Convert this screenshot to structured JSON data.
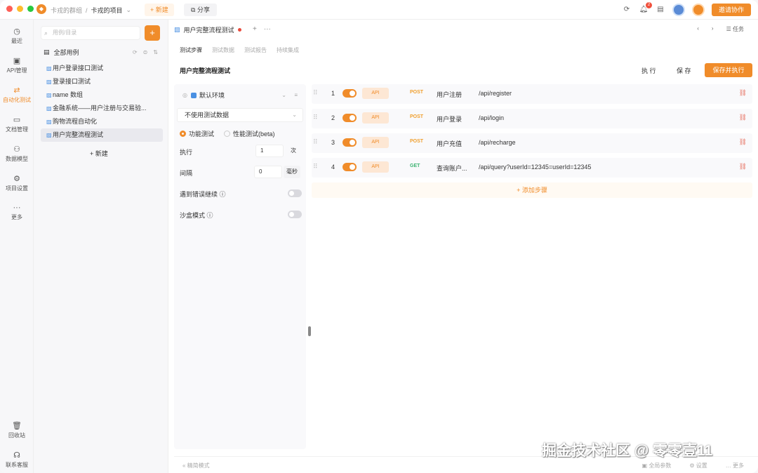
{
  "titlebar": {
    "team": "卡戎的群组",
    "sep": "/",
    "project": "卡戎的项目",
    "new_label": "+ 新建",
    "share_label": "分享",
    "notif_count": "2",
    "invite_label": "邀请协作"
  },
  "rail": {
    "items": [
      {
        "icon": "clock-icon",
        "label": "最近"
      },
      {
        "icon": "api-icon",
        "label": "API管理"
      },
      {
        "icon": "automation-icon",
        "label": "自动化测试"
      },
      {
        "icon": "doc-icon",
        "label": "文档管理"
      },
      {
        "icon": "model-icon",
        "label": "数据模型"
      },
      {
        "icon": "settings-icon",
        "label": "项目设置"
      },
      {
        "icon": "more-icon",
        "label": "更多"
      }
    ],
    "bottom": [
      {
        "icon": "trash-icon",
        "label": "回收站"
      },
      {
        "icon": "support-icon",
        "label": "联系客服"
      }
    ],
    "active_index": 2
  },
  "tree": {
    "search_placeholder": "用例/目录",
    "root_label": "全部用例",
    "items": [
      "用户登录接口测试",
      "登录接口测试",
      "name 数组",
      "金融系统——用户注册与交易验...",
      "购物流程自动化",
      "用户完整流程测试"
    ],
    "active_index": 5,
    "new_label": "+ 新建"
  },
  "main": {
    "doc_tab": "用户完整流程测试",
    "tasks_label": "任务",
    "subtabs": [
      "测试步骤",
      "测试数据",
      "测试报告",
      "持续集成"
    ],
    "case_title": "用户完整流程测试",
    "run_label": "执 行",
    "save_label": "保 存",
    "save_run_label": "保存并执行"
  },
  "config": {
    "env": "默认环境",
    "data": "不使用测试数据",
    "mode_functional": "功能测试",
    "mode_perf": "性能测试(beta)",
    "exec_label": "执行",
    "exec_value": "1",
    "exec_unit": "次",
    "interval_label": "间隔",
    "interval_value": "0",
    "interval_unit": "毫秒",
    "continue_on_error": "遇到错误继续",
    "sandbox": "沙盒模式"
  },
  "steps": [
    {
      "num": "1",
      "tag": "API",
      "method": "POST",
      "name": "用户注册",
      "path": "/api/register"
    },
    {
      "num": "2",
      "tag": "API",
      "method": "POST",
      "name": "用户登录",
      "path": "/api/login"
    },
    {
      "num": "3",
      "tag": "API",
      "method": "POST",
      "name": "用户充值",
      "path": "/api/recharge"
    },
    {
      "num": "4",
      "tag": "API",
      "method": "GET",
      "name": "查询账户...",
      "path": "/api/query?userId=12345=userId=12345"
    }
  ],
  "add_step_label": "+ 添加步骤",
  "bottombar": {
    "left": "« 精简模式",
    "global_params": "全局参数",
    "settings": "设置",
    "more": "更多"
  },
  "watermark": "掘金技术社区 @ 零零壹11",
  "colors": {
    "accent": "#f08c2a",
    "post": "#f0a030",
    "get": "#3cb371"
  }
}
